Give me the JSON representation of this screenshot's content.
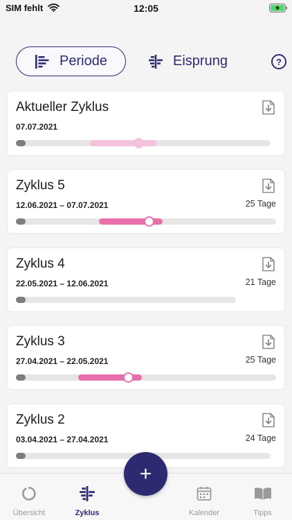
{
  "status_bar": {
    "carrier": "SIM fehlt",
    "time": "12:05"
  },
  "colors": {
    "accent": "#2d2a72",
    "fertile_light": "#f3c2dc",
    "fertile": "#e86fab"
  },
  "segments": {
    "periode_label": "Periode",
    "eisprung_label": "Eisprung",
    "help_label": "?"
  },
  "cycles": [
    {
      "title": "Aktueller Zyklus",
      "dates": "07.07.2021",
      "days": "",
      "track_end": 0.98,
      "fertile_start": 0.285,
      "fertile_end": 0.54,
      "fertile_color": "#f3c2dc",
      "ovulation": 0.47,
      "ovulation_style": "filled"
    },
    {
      "title": "Zyklus 5",
      "dates": "12.06.2021 – 07.07.2021",
      "days": "25 Tage",
      "track_end": 1.0,
      "fertile_start": 0.32,
      "fertile_end": 0.565,
      "fertile_color": "#e86fab",
      "ovulation": 0.51,
      "ovulation_style": "ring"
    },
    {
      "title": "Zyklus 4",
      "dates": "22.05.2021 – 12.06.2021",
      "days": "21 Tage",
      "track_end": 0.845,
      "fertile_start": null,
      "fertile_end": null,
      "fertile_color": "",
      "ovulation": null,
      "ovulation_style": ""
    },
    {
      "title": "Zyklus 3",
      "dates": "27.04.2021 – 22.05.2021",
      "days": "25 Tage",
      "track_end": 1.0,
      "fertile_start": 0.24,
      "fertile_end": 0.485,
      "fertile_color": "#e86fab",
      "ovulation": 0.43,
      "ovulation_style": "ring"
    },
    {
      "title": "Zyklus 2",
      "dates": "03.04.2021 – 27.04.2021",
      "days": "24 Tage",
      "track_end": 0.98,
      "fertile_start": null,
      "fertile_end": null,
      "fertile_color": "",
      "ovulation": null,
      "ovulation_style": ""
    }
  ],
  "fab_label": "+",
  "tabs": [
    {
      "label": "Übersicht",
      "icon": "circle-icon",
      "active": false
    },
    {
      "label": "Zyklus",
      "icon": "cycle-icon",
      "active": true
    },
    {
      "label": "Kalender",
      "icon": "calendar-icon",
      "active": false
    },
    {
      "label": "Tipps",
      "icon": "book-icon",
      "active": false
    }
  ]
}
